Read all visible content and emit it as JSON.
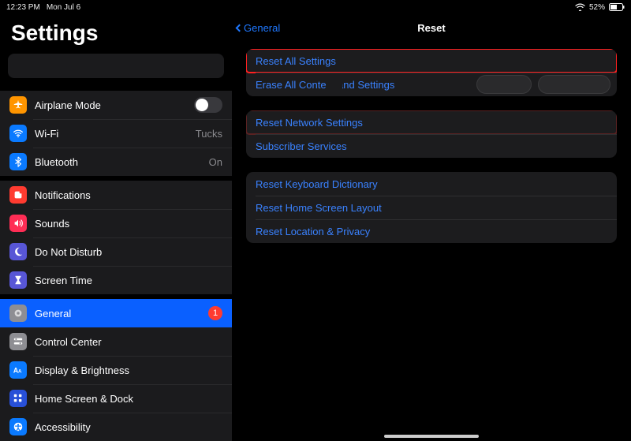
{
  "status": {
    "time": "12:23 PM",
    "date": "Mon Jul 6",
    "battery_pct": "52%"
  },
  "sidebar": {
    "title": "Settings",
    "rows": {
      "airplane": {
        "label": "Airplane Mode"
      },
      "wifi": {
        "label": "Wi-Fi",
        "value": "Tucks"
      },
      "bluetooth": {
        "label": "Bluetooth",
        "value": "On"
      },
      "notifications": {
        "label": "Notifications"
      },
      "sounds": {
        "label": "Sounds"
      },
      "dnd": {
        "label": "Do Not Disturb"
      },
      "screentime": {
        "label": "Screen Time"
      },
      "general": {
        "label": "General",
        "badge": "1"
      },
      "controlcenter": {
        "label": "Control Center"
      },
      "display": {
        "label": "Display & Brightness"
      },
      "homescreen": {
        "label": "Home Screen & Dock"
      },
      "accessibility": {
        "label": "Accessibility"
      }
    }
  },
  "detail": {
    "back_label": "General",
    "title": "Reset",
    "group1": {
      "reset_all": "Reset All Settings",
      "erase_all": "Erase All Content and Settings"
    },
    "group2": {
      "reset_network": "Reset Network Settings",
      "subscriber": "Subscriber Services"
    },
    "group3": {
      "keyboard": "Reset Keyboard Dictionary",
      "home_layout": "Reset Home Screen Layout",
      "location_privacy": "Reset Location & Privacy"
    }
  }
}
